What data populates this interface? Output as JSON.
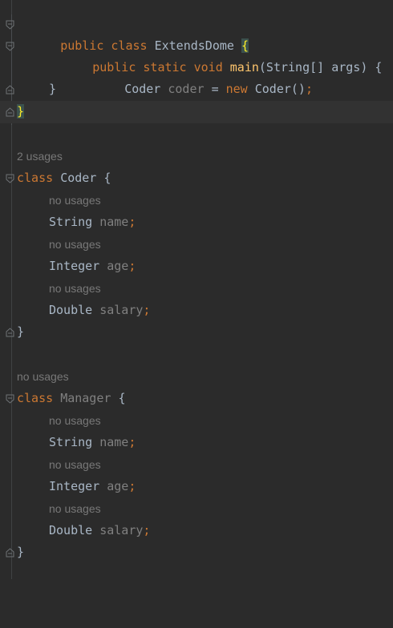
{
  "lines": {
    "l1": {
      "kw1": "public",
      "kw2": "class",
      "name": "ExtendsDome",
      "brace": "{"
    },
    "l2": {
      "kw1": "public",
      "kw2": "static",
      "kw3": "void",
      "fn": "main",
      "params": "(String[] args) {"
    },
    "l3": {
      "type": "Coder",
      "var": "coder",
      "eq": "=",
      "kw": "new",
      "call": "Coder()",
      "semi": ";"
    },
    "l4": {
      "brace": "}"
    },
    "l5": {
      "brace": "}"
    }
  },
  "coder_class": {
    "usages": "2 usages",
    "kw": "class",
    "name": "Coder",
    "brace": "{",
    "fields": [
      {
        "usage": "no usages",
        "type": "String",
        "name": "name",
        "semi": ";"
      },
      {
        "usage": "no usages",
        "type": "Integer",
        "name": "age",
        "semi": ";"
      },
      {
        "usage": "no usages",
        "type": "Double",
        "name": "salary",
        "semi": ";"
      }
    ],
    "close": "}"
  },
  "manager_class": {
    "usages": "no usages",
    "kw": "class",
    "name": "Manager",
    "brace": "{",
    "fields": [
      {
        "usage": "no usages",
        "type": "String",
        "name": "name",
        "semi": ";"
      },
      {
        "usage": "no usages",
        "type": "Integer",
        "name": "age",
        "semi": ";"
      },
      {
        "usage": "no usages",
        "type": "Double",
        "name": "salary",
        "semi": ";"
      }
    ],
    "close": "}"
  },
  "colors": {
    "background": "#2b2b2b",
    "keyword": "#cc7832",
    "method": "#ffc66d",
    "text": "#a9b7c6",
    "unused": "#808080",
    "brace_highlight": "#ffef28"
  }
}
